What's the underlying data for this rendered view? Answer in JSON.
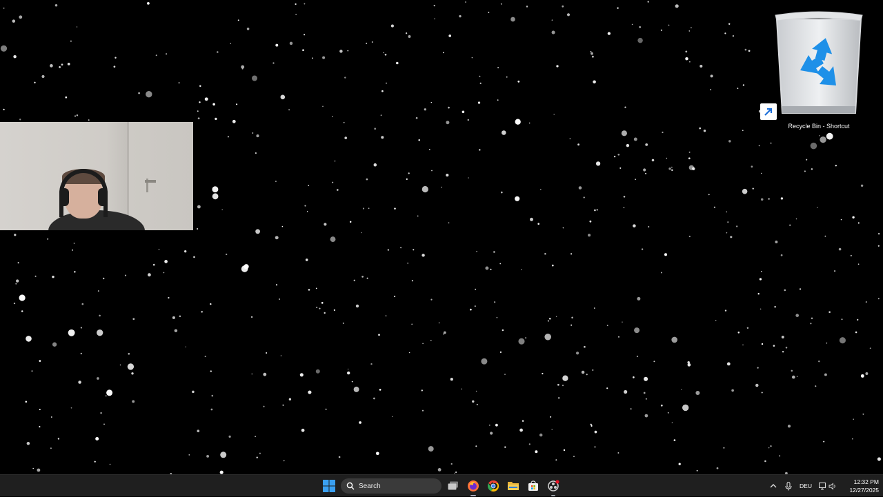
{
  "desktop": {
    "background": "#000000",
    "wallpaper": "starfield",
    "icons": [
      {
        "label": "Recycle Bin - Shortcut",
        "icon": "recycle-bin-icon",
        "shortcut": true
      }
    ]
  },
  "webcam": {
    "visible": true,
    "icon": "webcam-overlay"
  },
  "taskbar": {
    "background": "#1f1f1f",
    "start_icon": "windows-start-icon",
    "search_placeholder": "Search",
    "apps": [
      {
        "name": "task-view",
        "icon": "task-view-icon"
      },
      {
        "name": "firefox",
        "icon": "firefox-icon",
        "running": true
      },
      {
        "name": "chrome",
        "icon": "chrome-icon"
      },
      {
        "name": "file-explorer",
        "icon": "folder-icon"
      },
      {
        "name": "microsoft-store",
        "icon": "store-icon"
      },
      {
        "name": "obs",
        "icon": "record-app-icon",
        "running": true
      }
    ],
    "tray": {
      "language": "DEU",
      "time": "12:32 PM",
      "date": "12/27/2025"
    }
  },
  "colors": {
    "accent": "#0078d4",
    "recycle": "#1e90e8"
  }
}
